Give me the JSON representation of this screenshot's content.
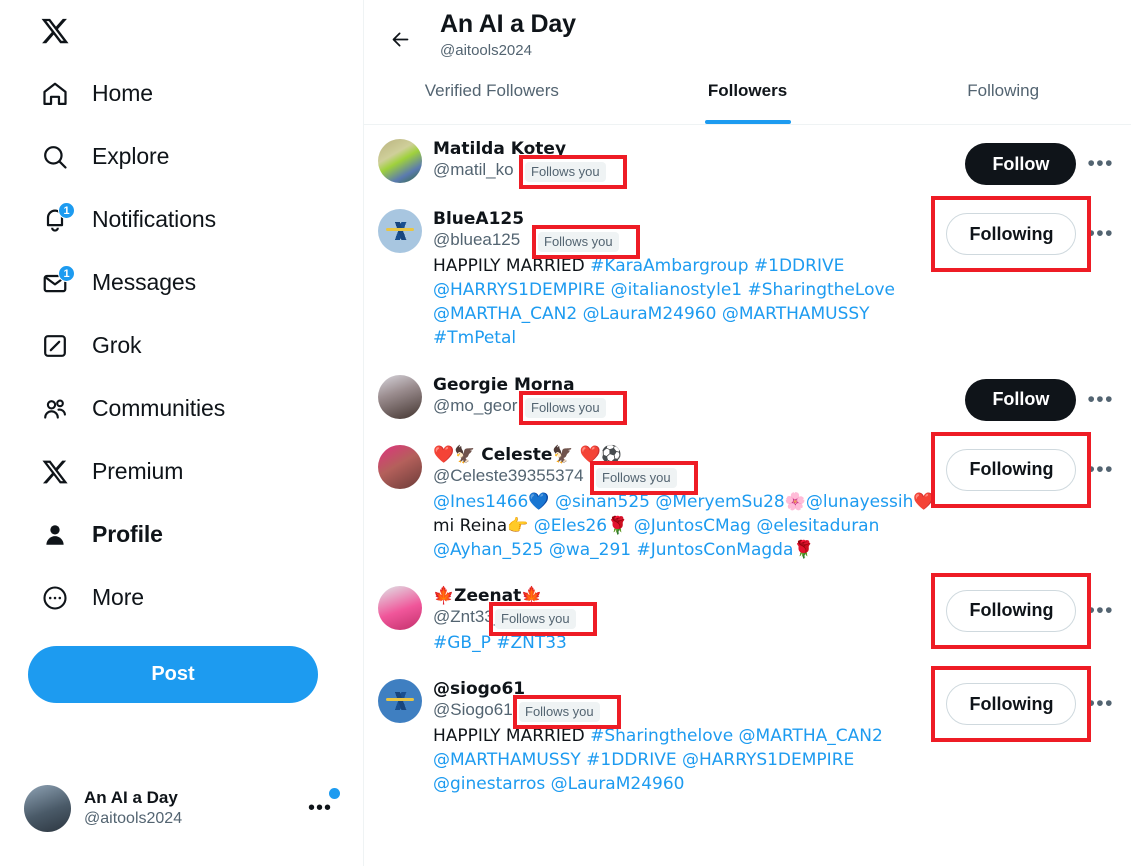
{
  "sidebar": {
    "logo": "X",
    "items": [
      {
        "label": "Home",
        "icon": "home-icon",
        "badge": null,
        "active": false
      },
      {
        "label": "Explore",
        "icon": "search-icon",
        "badge": null,
        "active": false
      },
      {
        "label": "Notifications",
        "icon": "bell-icon",
        "badge": "1",
        "active": false
      },
      {
        "label": "Messages",
        "icon": "envelope-icon",
        "badge": "1",
        "active": false
      },
      {
        "label": "Grok",
        "icon": "grok-icon",
        "badge": null,
        "active": false
      },
      {
        "label": "Communities",
        "icon": "communities-icon",
        "badge": null,
        "active": false
      },
      {
        "label": "Premium",
        "icon": "x-premium-icon",
        "badge": null,
        "active": false
      },
      {
        "label": "Profile",
        "icon": "person-icon",
        "badge": null,
        "active": true
      },
      {
        "label": "More",
        "icon": "more-circle-icon",
        "badge": null,
        "active": false
      }
    ],
    "post_button": "Post",
    "account": {
      "name": "An AI a Day",
      "handle": "@aitools2024",
      "more": "•••"
    }
  },
  "header": {
    "back": "←",
    "title": "An AI a Day",
    "handle": "@aitools2024"
  },
  "tabs": [
    {
      "label": "Verified Followers",
      "active": false
    },
    {
      "label": "Followers",
      "active": true
    },
    {
      "label": "Following",
      "active": false
    }
  ],
  "accent_colors": {
    "brand_blue": "#1d9bf0",
    "link_blue": "#1d9bf0",
    "text_primary": "#0f1419",
    "text_secondary": "#536471",
    "annotation_red": "#ee1c25",
    "badge_bg": "#eff3f4",
    "follow_btn_bg": "#0f1419"
  },
  "followers": [
    {
      "name": "Matilda Kotey",
      "handle": "@matil_ko",
      "follows_you": "Follows you",
      "bio_parts": [],
      "action": "Follow",
      "action_type": "follow",
      "more": "•••",
      "highlight_badge": true,
      "highlight_action": false
    },
    {
      "name": "BlueA125",
      "handle": "@bluea125",
      "follows_you": "Follows you",
      "bio_parts": [
        {
          "t": "HAPPILY MARRIED ",
          "link": false
        },
        {
          "t": "#KaraAmbargroup #1DDRIVE @HARRYS1DEMPIRE @italianostyle1 #SharingtheLove @MARTHA_CAN2 @LauraM24960 @MARTHAMUSSY #TmPetal",
          "link": true
        }
      ],
      "action": "Following",
      "action_type": "following",
      "more": "•••",
      "highlight_badge": true,
      "highlight_action": true
    },
    {
      "name": "Georgie Morna",
      "handle": "@mo_geor",
      "follows_you": "Follows you",
      "bio_parts": [],
      "action": "Follow",
      "action_type": "follow",
      "more": "•••",
      "highlight_badge": true,
      "highlight_action": false
    },
    {
      "name": "❤️🦅 Celeste🦅 ❤️⚽",
      "handle": "@Celeste39355374",
      "follows_you": "Follows you",
      "bio_parts": [
        {
          "t": "@Ines1466",
          "link": true
        },
        {
          "t": "💙 ",
          "link": false
        },
        {
          "t": "@sinan525 @MeryemSu28",
          "link": true
        },
        {
          "t": "🌸",
          "link": false
        },
        {
          "t": "@lunayessih",
          "link": true
        },
        {
          "t": "❤️ mi Reina👉 ",
          "link": false
        },
        {
          "t": "@Eles26",
          "link": true
        },
        {
          "t": "🌹 ",
          "link": false
        },
        {
          "t": "@JuntosCMag @elesitaduran @Ayhan_525 @wa_291 #JuntosConMagda",
          "link": true
        },
        {
          "t": "🌹",
          "link": false
        }
      ],
      "action": "Following",
      "action_type": "following",
      "more": "•••",
      "highlight_badge": true,
      "highlight_action": true
    },
    {
      "name": "🍁Zeenat🍁",
      "handle": "@Znt33_",
      "follows_you": "Follows you",
      "bio_parts": [
        {
          "t": "#GB_P #ZNT33",
          "link": true
        }
      ],
      "action": "Following",
      "action_type": "following",
      "more": "•••",
      "highlight_badge": true,
      "highlight_action": true
    },
    {
      "name": "@siogo61",
      "handle": "@Siogo61",
      "follows_you": "Follows you",
      "bio_parts": [
        {
          "t": "HAPPILY MARRIED ",
          "link": false
        },
        {
          "t": "#Sharingthelove @MARTHA_CAN2 @MARTHAMUSSY #1DDRIVE @HARRYS1DEMPIRE @ginestarros @LauraM24960",
          "link": true
        }
      ],
      "action": "Following",
      "action_type": "following",
      "more": "•••",
      "highlight_badge": true,
      "highlight_action": true
    }
  ]
}
